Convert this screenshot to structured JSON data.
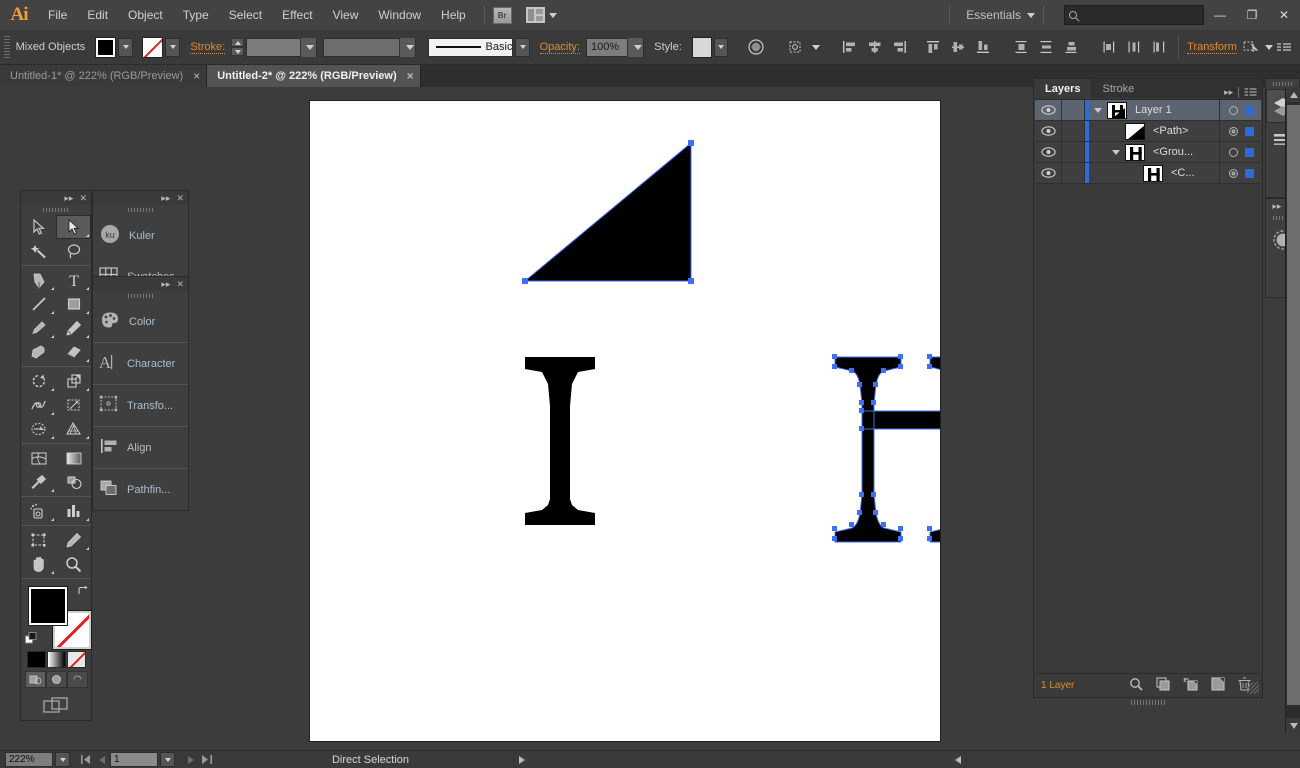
{
  "app": {
    "name": "Ai",
    "logo_color": "#f0a030"
  },
  "menubar": {
    "items": [
      "File",
      "Edit",
      "Object",
      "Type",
      "Select",
      "Effect",
      "View",
      "Window",
      "Help"
    ],
    "bridge_label": "Br",
    "workspace": "Essentials",
    "search_placeholder": "",
    "search_value": "",
    "window_buttons": {
      "minimize": "—",
      "restore": "❐",
      "close": "✕"
    }
  },
  "controlbar": {
    "selection_label": "Mixed Objects",
    "fill_color": "#000000",
    "stroke_swatch": "none",
    "stroke_label": "Stroke:",
    "stroke_weight": "",
    "stroke_profile": "",
    "brush_label": "Basic",
    "opacity_label": "Opacity:",
    "opacity_value": "100%",
    "style_label": "Style:",
    "transform_label": "Transform"
  },
  "tabs": [
    {
      "title": "Untitled-1* @ 222% (RGB/Preview)",
      "active": false,
      "close": "×"
    },
    {
      "title": "Untitled-2* @ 222% (RGB/Preview)",
      "active": true,
      "close": "×"
    }
  ],
  "toolbar": {
    "active_tool": "direct-selection",
    "tools": [
      "selection-tool",
      "direct-selection-tool",
      "magic-wand-tool",
      "lasso-tool",
      "pen-tool",
      "type-tool",
      "line-segment-tool",
      "rectangle-tool",
      "paintbrush-tool",
      "pencil-tool",
      "blob-brush-tool",
      "eraser-tool",
      "rotate-tool",
      "scale-tool",
      "width-tool",
      "free-transform-tool",
      "shape-builder-tool",
      "perspective-grid-tool",
      "mesh-tool",
      "gradient-tool",
      "eyedropper-tool",
      "blend-tool",
      "symbol-sprayer-tool",
      "column-graph-tool",
      "artboard-tool",
      "slice-tool",
      "hand-tool",
      "zoom-tool"
    ],
    "fill_color": "#000000",
    "stroke_color": "none",
    "color_modes": [
      "color",
      "gradient",
      "none"
    ],
    "draw_modes": [
      "draw-normal",
      "draw-behind",
      "draw-inside"
    ],
    "screen_mode": "change-screen-mode"
  },
  "dock_panels": {
    "group1": [
      {
        "label": "Kuler",
        "icon": "kuler-icon"
      },
      {
        "label": "Swatches",
        "icon": "swatches-icon"
      }
    ],
    "group2": [
      {
        "label": "Color",
        "icon": "color-icon"
      },
      {
        "label": "Character",
        "icon": "character-icon"
      },
      {
        "label": "Transfo...",
        "icon": "transform-icon"
      },
      {
        "label": "Align",
        "icon": "align-icon"
      },
      {
        "label": "Pathfin...",
        "icon": "pathfinder-icon"
      }
    ]
  },
  "layers_panel": {
    "tabs": [
      {
        "label": "Layers",
        "active": true
      },
      {
        "label": "Stroke",
        "active": false
      }
    ],
    "rows": [
      {
        "name": "Layer 1",
        "indent": 0,
        "expanded": true,
        "has_disclosure": true,
        "selected": true,
        "target_double": false
      },
      {
        "name": "<Path>",
        "indent": 1,
        "expanded": false,
        "has_disclosure": false,
        "selected": false,
        "target_double": true
      },
      {
        "name": "<Grou...",
        "indent": 1,
        "expanded": true,
        "has_disclosure": true,
        "selected": false,
        "target_double": false
      },
      {
        "name": "<C...",
        "indent": 2,
        "expanded": false,
        "has_disclosure": false,
        "selected": false,
        "target_double": true
      }
    ],
    "layer_color": "#2f6bd8",
    "footer_count": "1 Layer",
    "footer_icons": [
      "locate-object-icon",
      "make-clipping-mask-icon",
      "create-new-sublayer-icon",
      "create-new-layer-icon",
      "delete-selection-icon"
    ]
  },
  "edge_dock": {
    "buttons": [
      "layers-panel-icon",
      "stroke-panel-icon",
      "appearance-panel-icon"
    ]
  },
  "statusbar": {
    "zoom": "222%",
    "artboard_number": "1",
    "status_text": "Direct Selection"
  },
  "artwork": {
    "description": "serif-letter-H-with-triangle",
    "fill": "#000000",
    "anchor_color": "#3f6ff5",
    "path_color": "#3f6ff5"
  }
}
